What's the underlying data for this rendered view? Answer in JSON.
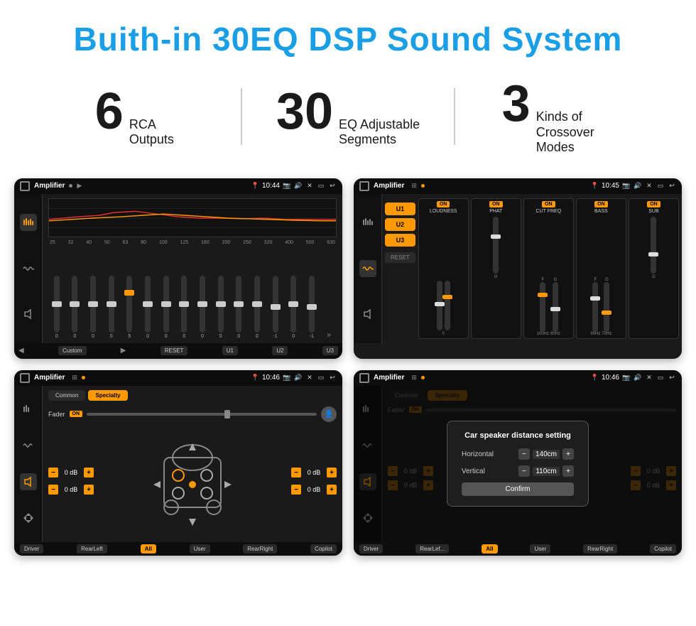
{
  "header": {
    "title": "Buith-in 30EQ DSP Sound System"
  },
  "stats": [
    {
      "number": "6",
      "desc_line1": "RCA",
      "desc_line2": "Outputs"
    },
    {
      "number": "30",
      "desc_line1": "EQ Adjustable",
      "desc_line2": "Segments"
    },
    {
      "number": "3",
      "desc_line1": "Kinds of",
      "desc_line2": "Crossover Modes"
    }
  ],
  "screens": {
    "eq_screen": {
      "title": "Amplifier",
      "time": "10:44",
      "eq_freqs": [
        "25",
        "32",
        "40",
        "50",
        "63",
        "80",
        "100",
        "125",
        "160",
        "200",
        "250",
        "320",
        "400",
        "500",
        "630"
      ],
      "eq_values": [
        "0",
        "0",
        "0",
        "0",
        "5",
        "0",
        "0",
        "0",
        "0",
        "0",
        "0",
        "0",
        "-1",
        "0",
        "-1"
      ],
      "preset": "Custom",
      "buttons": [
        "RESET",
        "U1",
        "U2",
        "U3"
      ]
    },
    "dsp_screen": {
      "title": "Amplifier",
      "time": "10:45",
      "u_buttons": [
        "U1",
        "U2",
        "U3"
      ],
      "channels": [
        {
          "label": "LOUDNESS",
          "on": true
        },
        {
          "label": "PHAT",
          "on": true
        },
        {
          "label": "CUT FREQ",
          "on": true
        },
        {
          "label": "BASS",
          "on": true
        },
        {
          "label": "SUB",
          "on": true
        }
      ],
      "reset_label": "RESET"
    },
    "fader_screen": {
      "title": "Amplifier",
      "time": "10:46",
      "tabs": [
        "Common",
        "Specialty"
      ],
      "fader_label": "Fader",
      "fader_on": true,
      "db_rows": [
        {
          "value": "0 dB"
        },
        {
          "value": "0 dB"
        },
        {
          "value": "0 dB"
        },
        {
          "value": "0 dB"
        }
      ],
      "bottom_buttons": [
        "Driver",
        "RearLeft",
        "All",
        "User",
        "RearRight",
        "Copilot"
      ]
    },
    "distance_screen": {
      "title": "Amplifier",
      "time": "10:46",
      "tabs": [
        "Common",
        "Specialty"
      ],
      "dialog": {
        "title": "Car speaker distance setting",
        "horizontal_label": "Horizontal",
        "horizontal_value": "140cm",
        "vertical_label": "Vertical",
        "vertical_value": "110cm",
        "confirm_label": "Confirm"
      },
      "db_rows": [
        {
          "value": "0 dB"
        },
        {
          "value": "0 dB"
        }
      ]
    }
  }
}
